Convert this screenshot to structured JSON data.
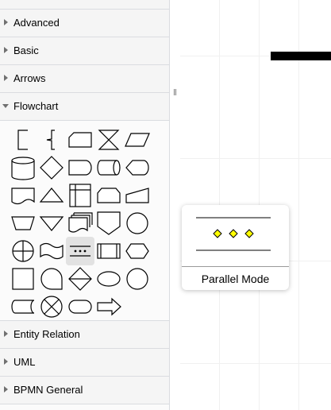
{
  "sidebar": {
    "sections_top": [
      {
        "label": "Advanced",
        "expanded": false
      },
      {
        "label": "Basic",
        "expanded": false
      },
      {
        "label": "Arrows",
        "expanded": false
      },
      {
        "label": "Flowchart",
        "expanded": true
      }
    ],
    "sections_bottom": [
      {
        "label": "Entity Relation",
        "expanded": false
      },
      {
        "label": "UML",
        "expanded": false
      },
      {
        "label": "BPMN General",
        "expanded": false
      }
    ],
    "flowchart_shapes": [
      "annotation-1",
      "annotation-2",
      "card",
      "collate",
      "data",
      "database",
      "decision",
      "delay",
      "direct-data",
      "display",
      "document",
      "extract",
      "internal-storage",
      "loop-limit",
      "manual-input",
      "manual-operation",
      "merge",
      "multi-document",
      "off-page-reference",
      "on-page-reference",
      "or",
      "paper-tape",
      "parallel-mode",
      "predefined-process",
      "preparation",
      "process",
      "sequential-data",
      "sort",
      "start",
      "start-2",
      "stored-data",
      "summing-function",
      "terminator",
      "transfer"
    ],
    "hovered_shape": "parallel-mode"
  },
  "tooltip": {
    "title": "Parallel Mode",
    "diamond_color": "#ffff00"
  }
}
